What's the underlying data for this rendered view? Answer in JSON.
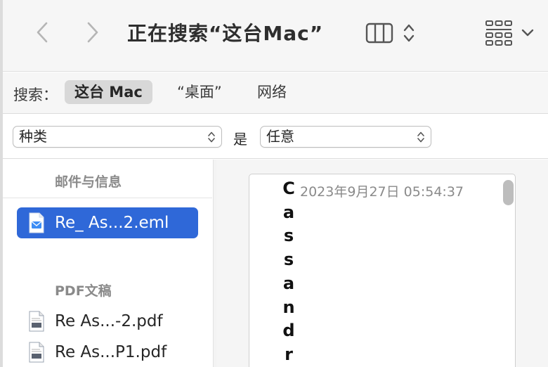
{
  "toolbar": {
    "title": "正在搜索“这台Mac”",
    "back_icon": "chevron-left-icon",
    "forward_icon": "chevron-right-icon",
    "view_icon": "column-view-icon",
    "group_icon": "grid-group-icon"
  },
  "scope": {
    "label": "搜索：",
    "options": [
      "这台 Mac",
      "“桌面”",
      "网络"
    ],
    "selected": "这台 Mac"
  },
  "criteria": {
    "attribute": "种类",
    "operator": "是",
    "value": "任意"
  },
  "results": {
    "sections": [
      {
        "title": "邮件与信息",
        "items": [
          {
            "name": "Re_ As...2.eml",
            "icon": "mail-doc-icon",
            "selected": true
          }
        ]
      },
      {
        "title": "PDF文稿",
        "items": [
          {
            "name": "Re As...-2.pdf",
            "icon": "pdf-doc-icon",
            "selected": false
          },
          {
            "name": "Re As...P1.pdf",
            "icon": "pdf-doc-icon",
            "selected": false
          }
        ]
      }
    ]
  },
  "preview": {
    "sender_letters": [
      "C",
      "a",
      "s",
      "s",
      "a",
      "n",
      "d",
      "r"
    ],
    "date": "2023年9月27日 05:54:37"
  },
  "colors": {
    "selection": "#2f68d8",
    "toolbar_bg": "#f6f6f6",
    "section_header": "#8a8a8a"
  }
}
